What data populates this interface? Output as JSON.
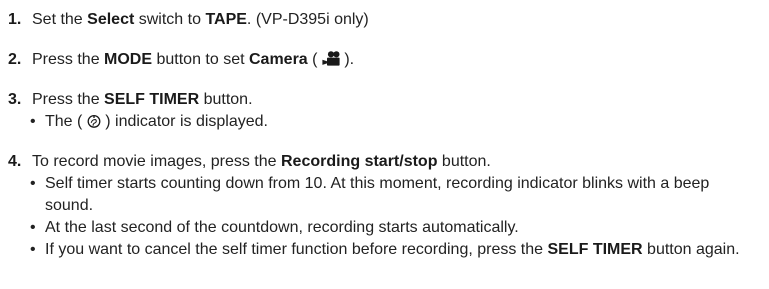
{
  "steps": [
    {
      "number": "1.",
      "parts": [
        "Set the ",
        "Select",
        " switch to ",
        "TAPE",
        ". (VP-D395i only)"
      ]
    },
    {
      "number": "2.",
      "parts": [
        "Press the ",
        "MODE",
        " button to set ",
        "Camera",
        " ( ",
        " )."
      ],
      "icon": "camera-mode-icon"
    },
    {
      "number": "3.",
      "parts": [
        "Press the ",
        "SELF TIMER",
        " button."
      ],
      "bullets": [
        {
          "parts": [
            "The ( ",
            " ) indicator is displayed."
          ],
          "icon": "self-timer-icon"
        }
      ]
    },
    {
      "number": "4.",
      "parts": [
        "To record movie images, press the ",
        "Recording start/stop",
        " button."
      ],
      "bullets": [
        {
          "text": "Self timer starts counting down from 10. At this moment, recording indicator blinks with a beep sound."
        },
        {
          "text": "At the last second of the countdown, recording starts automatically."
        },
        {
          "parts": [
            "If you want to cancel the self timer function before recording, press the ",
            "SELF TIMER",
            " button again."
          ]
        }
      ]
    }
  ],
  "bullet_symbol": "•",
  "colors": {
    "text": "#222222",
    "bold": "#1a1a1a"
  }
}
